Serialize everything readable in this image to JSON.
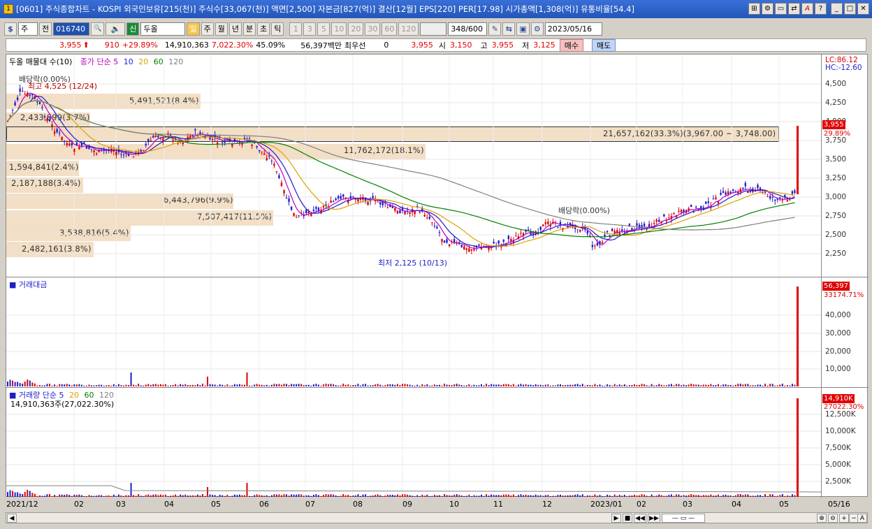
{
  "window": {
    "title": "[0601] 주식종합차트 - KOSPI 외국인보유[215(천)] 주식수[33,067(천)] 액면[2,500] 자본금[827(억)] 결산[12월] EPS[220] PER[17.98] 시가총액[1,308(억)] 유통비율[54.4]",
    "buttons": [
      "⊞",
      "⚙",
      "▭",
      "⇄",
      "A",
      "?",
      "_",
      "□",
      "✕"
    ]
  },
  "toolbar": {
    "mode": "주",
    "prev": "전",
    "code": "016740",
    "search_icon": "🔍",
    "market_badge": "신",
    "stock_name": "두올",
    "periods": [
      "일",
      "주",
      "월",
      "년",
      "분",
      "초",
      "틱"
    ],
    "active_period": "일",
    "intervals": [
      "1",
      "3",
      "5",
      "10",
      "20",
      "30",
      "60",
      "120"
    ],
    "count": "348",
    "count_total": "/600",
    "date": "2023/05/16"
  },
  "quote": {
    "price": "3,955",
    "arrow": "⬆",
    "change": "910",
    "change_pct": "+29.89%",
    "volume": "14,910,363",
    "volume_pct": "7,022.30%",
    "ratio": "45.09%",
    "amount": "56,397백만",
    "priority_label": "최우선",
    "priority_value": "0",
    "ask": "3,955",
    "open_label": "시",
    "open": "3,150",
    "high_label": "고",
    "high": "3,955",
    "low_label": "저",
    "low": "3,125",
    "buy": "매수",
    "sell": "매도"
  },
  "price_pane": {
    "profile_title": "두올 매물대 수(10)",
    "ma_title": "종가 단순 5",
    "ma_periods": [
      "10",
      "20",
      "60",
      "120"
    ],
    "ma_colors": [
      "#c000c0",
      "#1f1fc8",
      "#e0a000",
      "#008000",
      "#808080"
    ],
    "ticks": [
      "4,500",
      "4,250",
      "4,000",
      "3,750",
      "3,500",
      "3,250",
      "3,000",
      "2,750",
      "2,500",
      "2,250"
    ],
    "lc": "LC:86.12",
    "hc": "HC:-12.60",
    "last_tag": "3,955",
    "last_pct": "29.89%",
    "event_left": "배당락(0.00%)",
    "event_right": "배당락(0.00%)",
    "high_note": "최고 4,525 (12/24)",
    "low_note": "최저 2,125 (10/13)",
    "profiles": [
      "5,491,521(8.4%)",
      "2,433,899(3.7%)",
      "21,657,162(33.3%)(3,967.00 ~ 3,748.00)",
      "11,762,172(18.1%)",
      "1,594,841(2.4%)",
      "2,187,188(3.4%)",
      "6,443,796(9.9%)",
      "7,507,417(11.5%)",
      "3,538,816(5.4%)",
      "2,482,161(3.8%)"
    ]
  },
  "amount_pane": {
    "title": "거래대금",
    "ticks": [
      "40,000",
      "30,000",
      "20,000",
      "10,000"
    ],
    "last_tag": "56,397",
    "ma_tag": "33174.71%"
  },
  "volume_pane": {
    "title": "거래량 단순 5",
    "ma_periods": [
      "20",
      "60",
      "120"
    ],
    "current": "14,910,363주(27,022.30%)",
    "ticks": [
      "12,500K",
      "10,000K",
      "7,500K",
      "5,000K",
      "2,500K"
    ],
    "last_tag": "14,910K",
    "ma_tag": "27022.30%"
  },
  "xaxis": [
    "2021/12",
    "02",
    "03",
    "04",
    "05",
    "06",
    "07",
    "08",
    "09",
    "10",
    "11",
    "12",
    "2023/01",
    "02",
    "03",
    "04",
    "05",
    "05/16"
  ],
  "scroll": {
    "buttons": [
      "◀",
      "▶",
      "■",
      "◀◀",
      "▶▶",
      "⊕",
      "⊖",
      "+",
      "−",
      "A"
    ]
  }
}
